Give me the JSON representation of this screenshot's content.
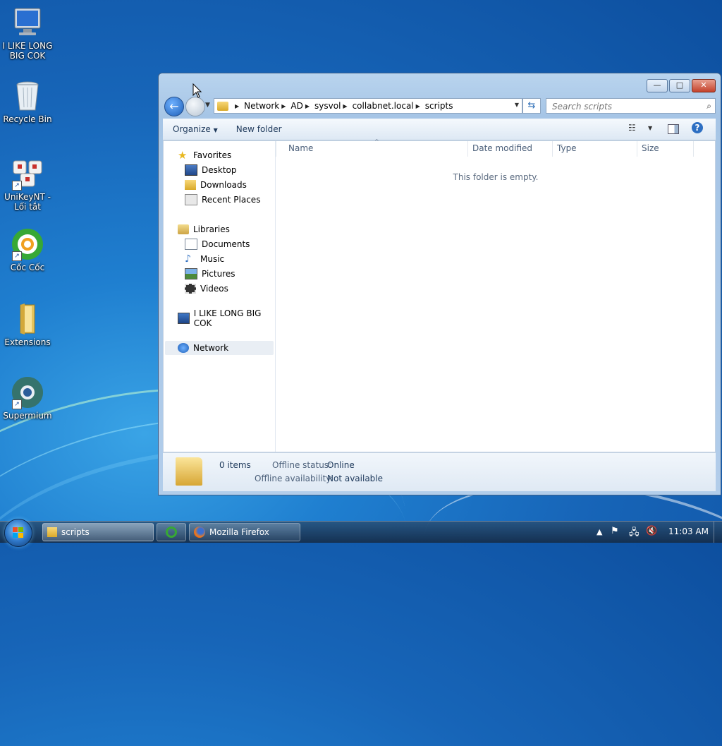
{
  "desktop": {
    "icons": [
      {
        "name": "computer",
        "label": "I LIKE LONG BIG COK"
      },
      {
        "name": "recycle-bin",
        "label": "Recycle Bin"
      },
      {
        "name": "unikey",
        "label": "UniKeyNT - Lối tắt"
      },
      {
        "name": "coc-coc",
        "label": "Cốc Cốc"
      },
      {
        "name": "extensions",
        "label": "Extensions"
      },
      {
        "name": "supermium",
        "label": "Supermium"
      }
    ]
  },
  "window": {
    "controls": {
      "minimize": "—",
      "maximize": "□",
      "close": "✕"
    },
    "address": {
      "breadcrumbs": [
        "Network",
        "AD",
        "sysvol",
        "collabnet.local",
        "scripts"
      ]
    },
    "search": {
      "placeholder": "Search scripts"
    },
    "toolbar": {
      "organize": "Organize",
      "new_folder": "New folder"
    },
    "nav": {
      "favorites": "Favorites",
      "favorites_items": [
        "Desktop",
        "Downloads",
        "Recent Places"
      ],
      "libraries": "Libraries",
      "libraries_items": [
        "Documents",
        "Music",
        "Pictures",
        "Videos"
      ],
      "computer": "I LIKE LONG BIG COK",
      "network": "Network"
    },
    "columns": [
      "Name",
      "Date modified",
      "Type",
      "Size"
    ],
    "empty_message": "This folder is empty.",
    "details": {
      "items": "0 items",
      "offline_status_label": "Offline status:",
      "offline_status_value": "Online",
      "offline_avail_label": "Offline availability:",
      "offline_avail_value": "Not available"
    }
  },
  "taskbar": {
    "tasks": [
      "scripts",
      "Mozilla Firefox"
    ],
    "clock": "11:03 AM"
  }
}
